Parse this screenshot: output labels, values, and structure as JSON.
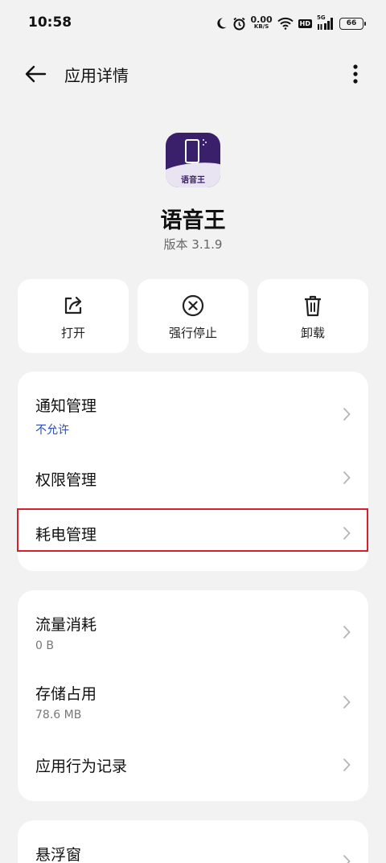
{
  "status_bar": {
    "time": "10:58",
    "net_speed_value": "0.00",
    "net_speed_unit": "KB/S",
    "hd_label": "HD",
    "signal_label": "5G",
    "battery_level": "66",
    "icons": [
      "moon-icon",
      "alarm-icon",
      "wifi-icon",
      "hd-icon",
      "signal-icon",
      "battery-icon"
    ]
  },
  "app_bar": {
    "title": "应用详情",
    "back_icon": "arrow-left-icon",
    "more_icon": "more-vertical-icon"
  },
  "app": {
    "name": "语音王",
    "version": "版本 3.1.9",
    "icon_text": "语音王",
    "icon_colors": {
      "primary": "#3a1f6a",
      "secondary": "#e9e4f1"
    }
  },
  "actions": [
    {
      "label": "打开",
      "icon": "open-external-icon"
    },
    {
      "label": "强行停止",
      "icon": "force-stop-icon"
    },
    {
      "label": "卸载",
      "icon": "trash-icon"
    }
  ],
  "group1": [
    {
      "title": "通知管理",
      "subtitle": "不允许",
      "subtitle_color": "#2a4fb8"
    },
    {
      "title": "权限管理"
    },
    {
      "title": "耗电管理"
    }
  ],
  "group2": [
    {
      "title": "流量消耗",
      "subtitle": "0 B"
    },
    {
      "title": "存储占用",
      "subtitle": "78.6 MB"
    },
    {
      "title": "应用行为记录"
    }
  ],
  "group3": [
    {
      "title": "悬浮窗"
    }
  ],
  "colors": {
    "background": "#f2f2f2",
    "card": "#ffffff",
    "highlight": "#d6202b",
    "chevron": "#b5b5b5"
  }
}
